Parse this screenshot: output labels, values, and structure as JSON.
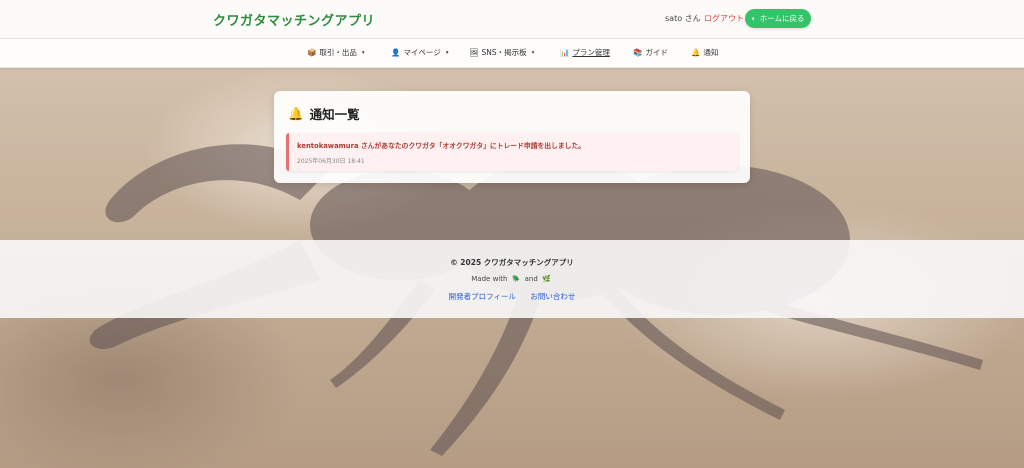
{
  "header": {
    "brand": "クワガタマッチングアプリ",
    "user_label": "sato さん",
    "logout_label": "ログアウト",
    "home_button_label": "ホームに戻る"
  },
  "nav": {
    "items": [
      {
        "icon": "📦",
        "label": "取引・出品",
        "caret": "▾"
      },
      {
        "icon": "👤",
        "label": "マイページ",
        "caret": "▾"
      },
      {
        "icon": "🖼",
        "label": "SNS・掲示板",
        "caret": "▾"
      },
      {
        "icon": "📊",
        "label": "プラン管理"
      },
      {
        "icon": "📚",
        "label": "ガイド"
      },
      {
        "icon": "🔔",
        "label": "通知"
      }
    ]
  },
  "notifications": {
    "title_icon": "🔔",
    "title": "通知一覧",
    "items": [
      {
        "message": "kentokawamura さんがあなたのクワガタ「オオクワガタ」にトレード申請を出しました。",
        "timestamp": "2025年06月30日 18:41"
      }
    ]
  },
  "footer": {
    "copyright": "© 2025 クワガタマッチングアプリ",
    "made_with": "Made with",
    "made_icon_1": "🪲",
    "and": "and",
    "made_icon_2": "🌿",
    "link_profile": "開発者プロフィール",
    "link_contact": "お問い合わせ"
  },
  "colors": {
    "brand": "#2e8b3c",
    "home_button": "#33c46a",
    "logout": "#e0453d",
    "notif_text": "#b03a32",
    "link": "#2a5bd7"
  }
}
